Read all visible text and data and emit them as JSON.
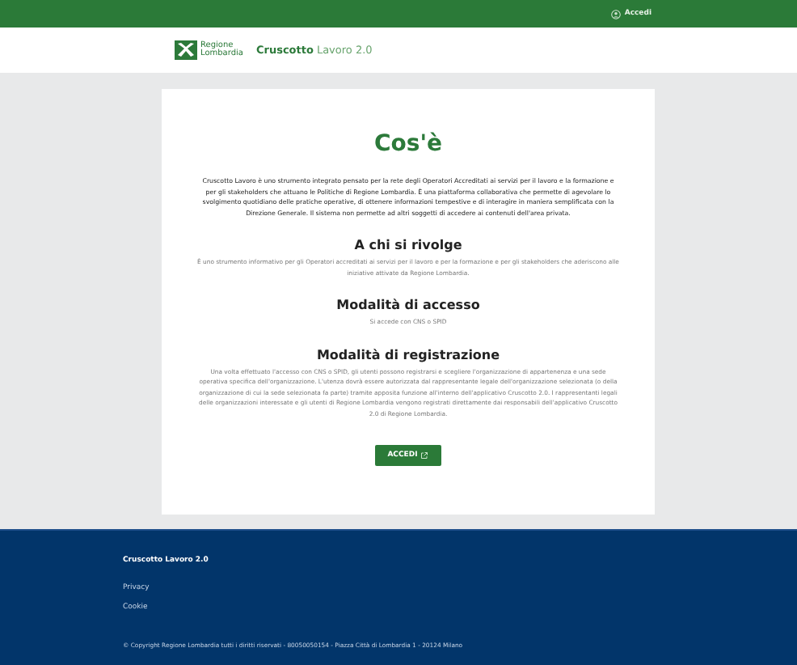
{
  "top_bar": {
    "login_label": "Accedi"
  },
  "header": {
    "logo_lines": [
      "Regione",
      "Lombardia"
    ],
    "app_name": "Cruscotto",
    "app_version": "Lavoro 2.0"
  },
  "main": {
    "title": "Cos'è",
    "intro": "Cruscotto Lavoro è uno strumento integrato pensato per la rete degli Operatori Accreditati ai servizi per il lavoro e la formazione e per gli stakeholders che attuano le Politiche di Regione Lombardia. È una piattaforma collaborativa che permette di agevolare lo svolgimento quotidiano delle pratiche operative, di ottenere informazioni tempestive e di interagire in maniera semplificata con la Direzione Generale. Il sistema non permette ad altri soggetti di accedere ai contenuti dell'area privata.",
    "sections": [
      {
        "heading": "A chi si rivolge",
        "text": "È uno strumento informativo per gli Operatori accreditati ai servizi per il lavoro e per la formazione e per gli stakeholders che aderiscono alle iniziative attivate da Regione Lombardia."
      },
      {
        "heading": "Modalità di accesso",
        "text": "Si accede con CNS o SPID"
      },
      {
        "heading": "Modalità di registrazione",
        "text": "Una volta effettuato l'accesso con CNS o SPID, gli utenti possono registrarsi e scegliere l'organizzazione di appartenenza e una sede operativa specifica dell'organizzazione. L'utenza dovrà essere autorizzata dal rappresentante legale dell'organizzazione selezionata (o della organizzazione di cui la sede selezionata fa parte) tramite apposita funzione all'interno dell'applicativo Cruscotto 2.0. I rappresentanti legali delle organizzazioni interessate e gli utenti di Regione Lombardia vengono registrati direttamente dai responsabili dell'applicativo Cruscotto 2.0 di Regione Lombardia."
      }
    ],
    "button": "ACCEDI"
  },
  "footer": {
    "title": "Cruscotto Lavoro 2.0",
    "links": [
      "Privacy",
      "Cookie"
    ],
    "copyright": "© Copyright Regione Lombardia tutti i diritti riservati - 80050050154 - Piazza Città di Lombardia 1 - 20124 Milano"
  }
}
